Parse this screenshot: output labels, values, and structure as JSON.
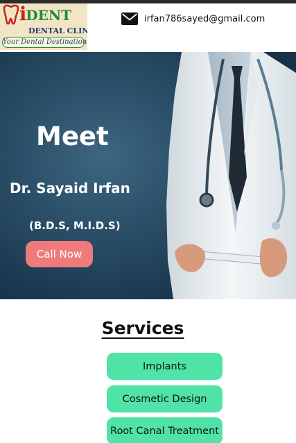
{
  "logo": {
    "brand_i": "i",
    "brand_rest": "DENT",
    "clinic": "DENTAL CLINIC",
    "tagline": "Your Dental Destination"
  },
  "contact": {
    "icon": "envelope-icon",
    "email": "irfan786sayed@gmail.com"
  },
  "hero": {
    "title": "Meet",
    "name": "Dr. Sayaid Irfan",
    "qualifications": "(B.D.S, M.I.D.S)",
    "cta_label": "Call Now"
  },
  "services": {
    "title": "Services",
    "items": [
      {
        "label": "Implants"
      },
      {
        "label": "Cosmetic Design"
      },
      {
        "label": "Root Canal Treatment"
      }
    ]
  },
  "colors": {
    "hero_background": "#2a4d66",
    "cta_button": "#ee7a7a",
    "service_button": "#4fe3a7",
    "logo_background": "#f1e5c3",
    "brand_red": "#c4221c",
    "brand_green": "#1f8a3c"
  }
}
